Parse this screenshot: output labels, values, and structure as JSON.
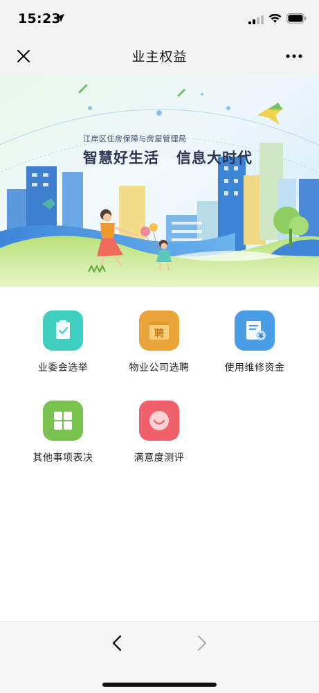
{
  "status_bar": {
    "time": "15:23"
  },
  "nav": {
    "title": "业主权益"
  },
  "banner": {
    "org_name": "江岸区住房保障与房屋管理局",
    "slogan": "智慧好生活   信息大时代"
  },
  "menu": {
    "items": [
      {
        "label": "业委会选举",
        "icon": "clipboard-check-icon",
        "color": "#3fcfc0"
      },
      {
        "label": "物业公司选聘",
        "icon": "recruit-box-icon",
        "color": "#eaa53a"
      },
      {
        "label": "使用维修资金",
        "icon": "funds-document-icon",
        "color": "#4a9ee8"
      },
      {
        "label": "其他事项表决",
        "icon": "grid-icon",
        "color": "#7ac24f"
      },
      {
        "label": "满意度测评",
        "icon": "smile-icon",
        "color": "#f0606a"
      }
    ],
    "recruit_glyph": "聘",
    "currency_glyph": "¥"
  },
  "colors": {
    "nav_background": "#f3f3f3",
    "bottom_bar_background": "#f7f7f7"
  }
}
